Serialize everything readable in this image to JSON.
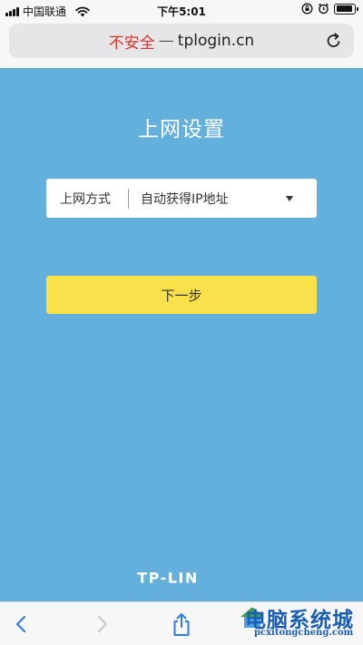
{
  "status_bar": {
    "carrier": "中国联通",
    "time": "下午5:01",
    "battery_level": 0.9
  },
  "url_bar": {
    "insecure_label": "不安全",
    "separator": "—",
    "host": "tplogin.cn"
  },
  "main": {
    "title": "上网设置",
    "connection": {
      "label": "上网方式",
      "selected": "自动获得IP地址"
    },
    "next_button": "下一步",
    "logo": "TP-LIN"
  },
  "watermark": {
    "text": "电脑系统城",
    "url": "pcxitongcheng.com"
  },
  "colors": {
    "background": "#62b0db",
    "button": "#f8e14b",
    "insecure": "#d9322b"
  }
}
